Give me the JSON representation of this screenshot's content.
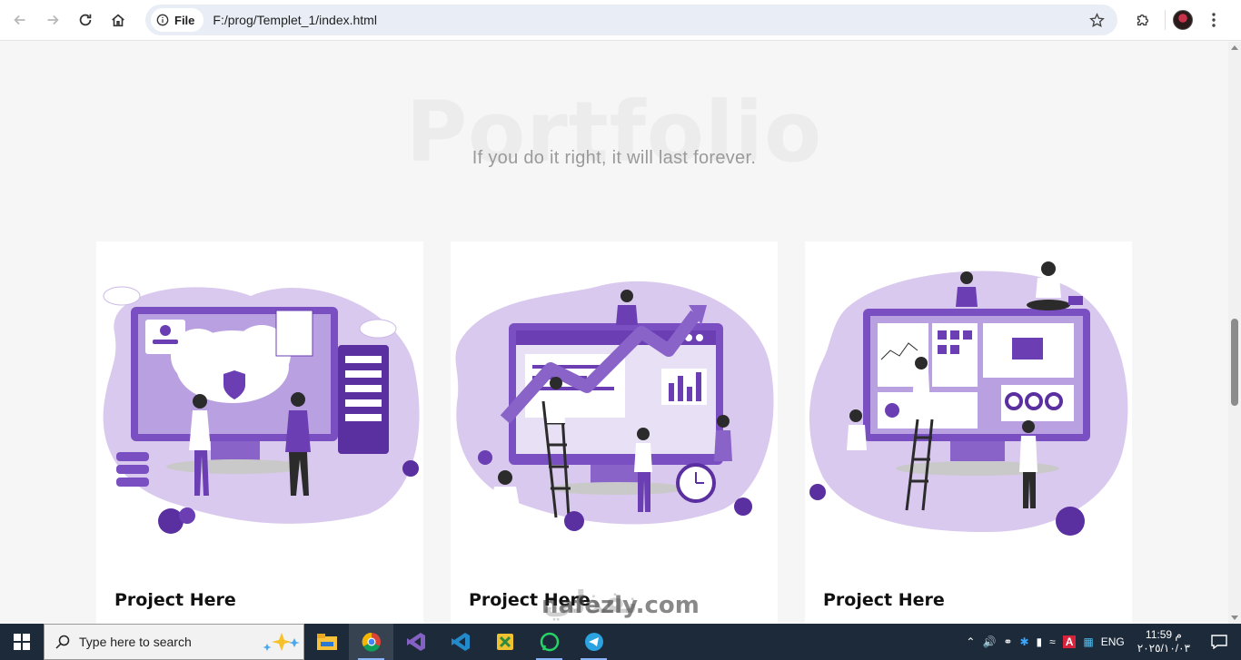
{
  "browser": {
    "chip_label": "File",
    "url": "F:/prog/Templet_1/index.html"
  },
  "section": {
    "bg_title": "Portfolio",
    "subtitle": "If you do it right, it will last forever."
  },
  "cards": [
    {
      "title": "Project Here",
      "illustration": "cloud-security-illustration"
    },
    {
      "title": "Project Here",
      "illustration": "growth-analytics-illustration"
    },
    {
      "title": "Project Here",
      "illustration": "web-development-illustration"
    }
  ],
  "watermark": {
    "arabic": "نفذلي",
    "latin": "nafezly.com"
  },
  "taskbar": {
    "search_placeholder": "Type here to search",
    "apps": [
      "file-explorer-icon",
      "chrome-icon",
      "visual-studio-icon",
      "vscode-icon",
      "app-icon",
      "whatsapp-icon",
      "telegram-icon"
    ],
    "language": "ENG",
    "time": "11:59 م",
    "date": "٢٠٢٥/١٠/٠٣"
  },
  "colors": {
    "accent_purple": "#6b3fb3",
    "light_purple": "#d9c9ee",
    "taskbar": "#1c2a3a"
  }
}
